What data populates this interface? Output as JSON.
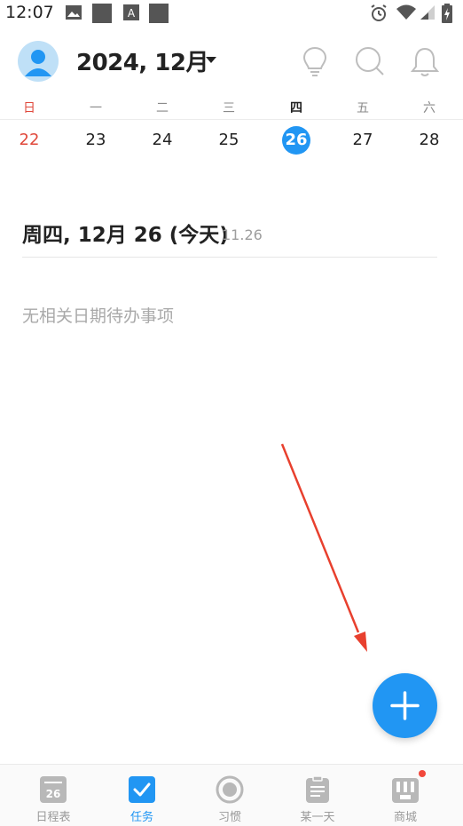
{
  "statusbar": {
    "time": "12:07"
  },
  "header": {
    "month_title": "2024, 12月",
    "icons": [
      "avatar",
      "lightbulb-icon",
      "search-icon",
      "bell-icon"
    ]
  },
  "weekdays": [
    "日",
    "一",
    "二",
    "三",
    "四",
    "五",
    "六"
  ],
  "week_dates": [
    "22",
    "23",
    "24",
    "25",
    "26",
    "27",
    "28"
  ],
  "today_index": 4,
  "colors": {
    "accent": "#2196f3",
    "sunday": "#e0483b",
    "arrow": "#e8402e"
  },
  "day_section": {
    "title": "周四, 12月 26 (今天)",
    "subtitle": "11.26",
    "empty_text": "无相关日期待办事项"
  },
  "fab": {
    "icon": "plus-icon"
  },
  "bottom_nav": {
    "items": [
      {
        "label": "日程表",
        "icon": "calendar-icon",
        "icon_text": "26"
      },
      {
        "label": "任务",
        "icon": "checkbox-icon"
      },
      {
        "label": "习惯",
        "icon": "habit-circle-icon"
      },
      {
        "label": "某一天",
        "icon": "clipboard-icon"
      },
      {
        "label": "商城",
        "icon": "store-icon"
      }
    ],
    "active_index": 1
  }
}
